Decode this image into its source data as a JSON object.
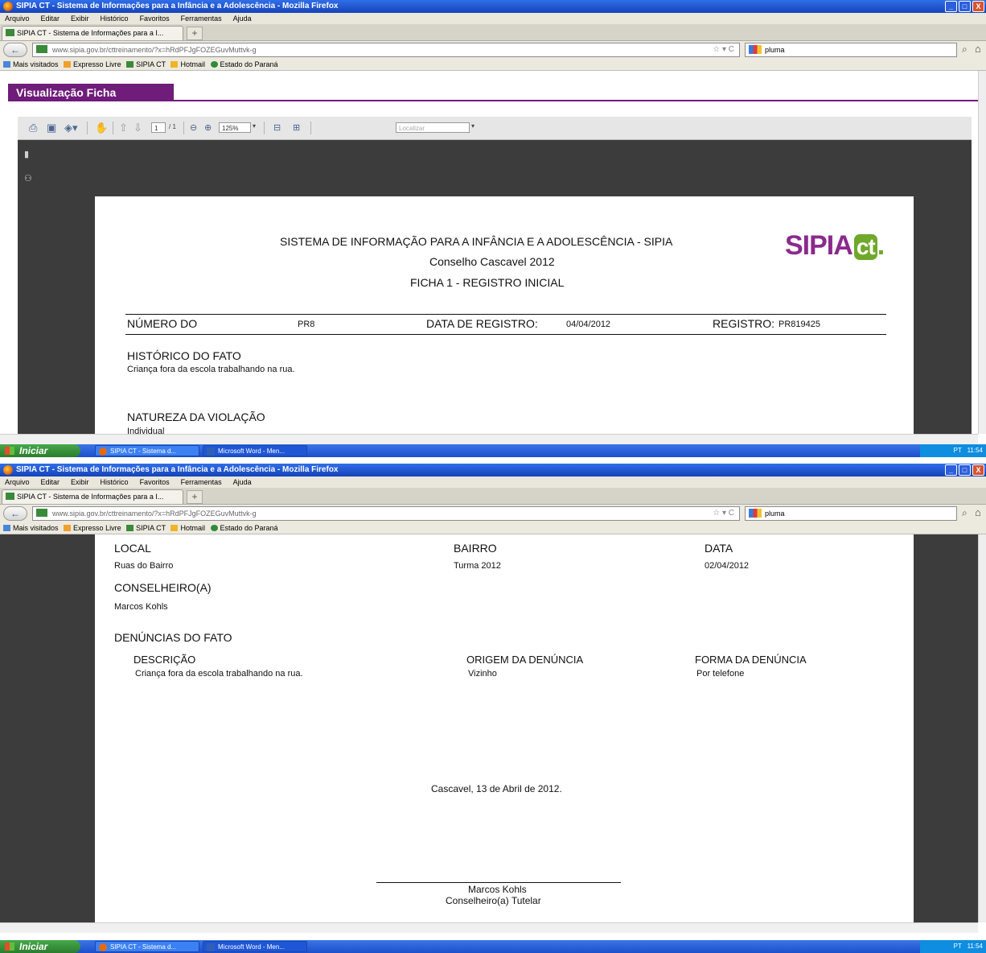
{
  "window": {
    "title": "SIPIA CT - Sistema de Informações para a Infância e a Adolescência - Mozilla Firefox",
    "min": "_",
    "max": "□",
    "close": "X"
  },
  "menu": [
    "Arquivo",
    "Editar",
    "Exibir",
    "Histórico",
    "Favoritos",
    "Ferramentas",
    "Ajuda"
  ],
  "tab": {
    "label": "SIPIA CT - Sistema de Informações para a I...",
    "close": "x",
    "new": "+"
  },
  "nav": {
    "back": "←",
    "url": "www.sipia.gov.br/cttreinamento/?x=hRdPFJgFOZEGuvMuttvk-g",
    "search_text": "pluma"
  },
  "bookmarks": [
    "Mais visitados",
    "Expresso Livre",
    "SIPIA CT",
    "Hotmail",
    "Estado do Paraná"
  ],
  "viz_title": "Visualização Ficha",
  "pdf_toolbar": {
    "page_current": "1",
    "page_total": "/ 1",
    "zoom": "125%",
    "find_placeholder": "Localizar"
  },
  "document": {
    "header1": "SISTEMA DE INFORMAÇÃO PARA A INFÂNCIA E A ADOLESCÊNCIA - SIPIA",
    "header2": "Conselho Cascavel 2012",
    "header3": "FICHA 1 - REGISTRO INICIAL",
    "logo_main": "SIPIA",
    "logo_ct": "ct",
    "logo_dot": ".",
    "numero_label": "NÚMERO DO",
    "numero_value": "PR8",
    "data_registro_label": "DATA DE REGISTRO:",
    "data_registro_value": "04/04/2012",
    "registro_label": "REGISTRO:",
    "registro_value": "PR819425",
    "historico_label": "HISTÓRICO DO FATO",
    "historico_value": "Criança fora da escola trabalhando na rua.",
    "natureza_label": "NATUREZA DA VIOLAÇÃO",
    "natureza_value": "Individual",
    "local_label": "LOCAL",
    "local_value": "Ruas do Bairro",
    "bairro_label": "BAIRRO",
    "bairro_value": "Turma 2012",
    "data_label": "DATA",
    "data_value": "02/04/2012",
    "conselheiro_label": "CONSELHEIRO(A)",
    "conselheiro_value": "Marcos Kohls",
    "denuncias_label": "DENÚNCIAS DO FATO",
    "descricao_label": "DESCRIÇÃO",
    "descricao_value": "Criança fora da escola trabalhando na rua.",
    "origem_label": "ORIGEM DA DENÚNCIA",
    "origem_value": "Vizinho",
    "forma_label": "FORMA DA DENÚNCIA",
    "forma_value": "Por telefone",
    "local_data": "Cascavel, 13 de Abril de 2012.",
    "assinatura_nome": "Marcos Kohls",
    "assinatura_cargo": "Conselheiro(a) Tutelar"
  },
  "taskbar": {
    "start": "Iniciar",
    "task1": "SIPIA CT - Sistema d...",
    "task2": "Microsoft Word - Men...",
    "lang": "PT",
    "clock": "11:54"
  },
  "icons": [
    "firefox-icon",
    "back-arrow-icon",
    "star-icon",
    "magnifier-icon",
    "home-icon",
    "print-icon",
    "save-icon",
    "zoom-out-icon",
    "zoom-in-icon",
    "pages-icon",
    "binoculars-icon",
    "windows-flag-icon"
  ]
}
